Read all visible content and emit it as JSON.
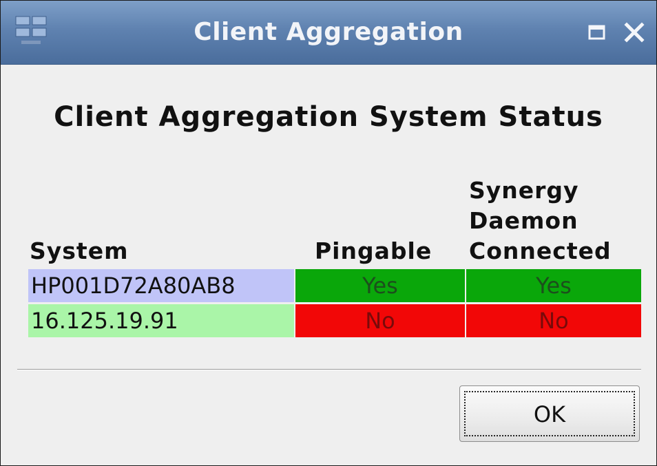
{
  "window": {
    "title": "Client Aggregation"
  },
  "heading": "Client Aggregation System Status",
  "table": {
    "headers": {
      "system": "System",
      "pingable": "Pingable",
      "synergy_line1": "Synergy",
      "synergy_line2": "Daemon",
      "synergy_line3": "Connected"
    },
    "rows": [
      {
        "system": "HP001D72A80AB8",
        "pingable": "Yes",
        "synergy": "Yes",
        "system_bg": "#c0c4f8",
        "pingable_bg": "#0aa70a",
        "synergy_bg": "#0aa70a",
        "text_color_status": "#1c4f1c"
      },
      {
        "system": "16.125.19.91",
        "pingable": "No",
        "synergy": "No",
        "system_bg": "#aaf5a8",
        "pingable_bg": "#f20707",
        "synergy_bg": "#f20707",
        "text_color_status": "#7a0a0a"
      }
    ]
  },
  "buttons": {
    "ok": "OK"
  },
  "icons": {
    "app": "app-grid-icon",
    "maximize": "maximize-icon",
    "close": "close-icon"
  }
}
